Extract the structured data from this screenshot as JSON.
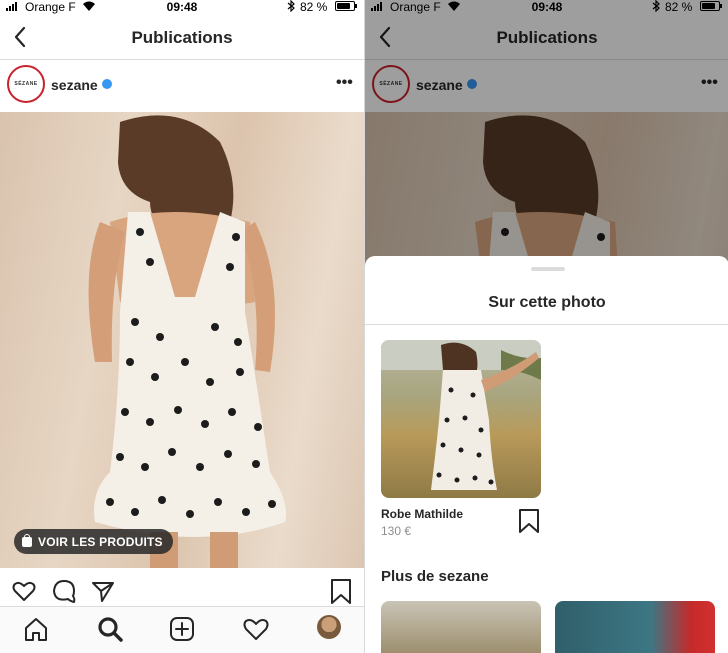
{
  "status_bar": {
    "carrier": "Orange F",
    "time": "09:48",
    "battery": "82 %",
    "battery_level": 0.82
  },
  "nav": {
    "title": "Publications"
  },
  "post": {
    "username": "sezane",
    "avatar_text": "SÉZANE",
    "cta_label": "VOIR LES PRODUITS"
  },
  "sheet": {
    "title": "Sur cette photo",
    "product": {
      "name": "Robe Mathilde",
      "price": "130 €"
    },
    "more_title": "Plus de sezane"
  },
  "colors": {
    "verified": "#3897f0",
    "avatar_ring": "#c8232c",
    "text": "#262626",
    "muted": "#8e8e8e"
  }
}
